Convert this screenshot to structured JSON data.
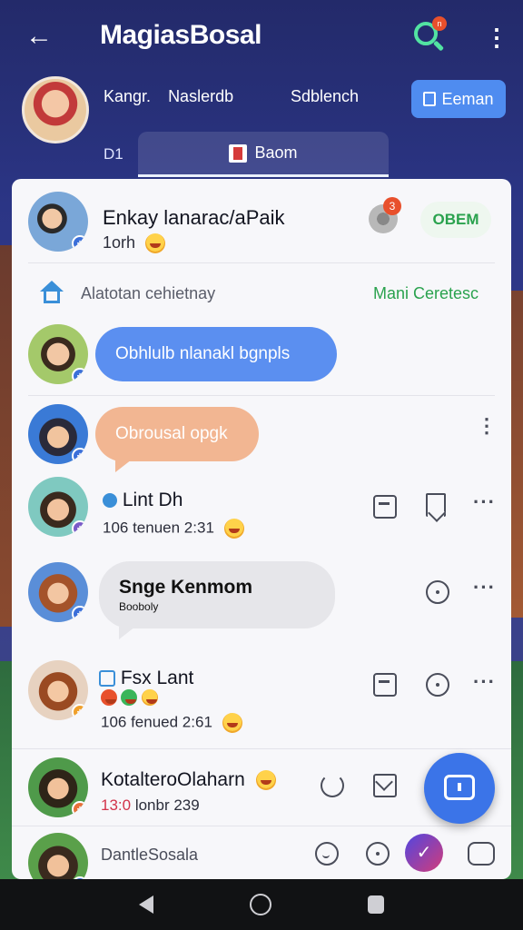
{
  "header": {
    "title": "MagiasBosal",
    "search_badge": "n",
    "profile_name": "Kangr.",
    "profile_sub": "Naslerdb",
    "sub_link": "Sdblench",
    "cta_label": "Eeman",
    "tab_left": "D1",
    "tab_active": "Baom"
  },
  "group": {
    "name": "Enkay lanarac/aPaik",
    "time": "1orh",
    "badge_count": "3",
    "pill": "OBEM"
  },
  "section": {
    "label": "Alatotan cehietnay",
    "action": "Mani Ceretesc"
  },
  "messages": {
    "m1_bubble": "Obhlulb nlanakl bgnpls",
    "m2_bubble": "Obrousal opgk",
    "m3_name": "Lint Dh",
    "m3_meta": "106 tenuen 2:31",
    "m4_title": "Snge Kenmom",
    "m4_sub": "Booboly",
    "m5_name": "Fsx Lant",
    "m5_meta": "106 fenued 2:61",
    "m6_name": "KotalteroOlaharn",
    "m6_time": "13:0",
    "m6_meta": "lonbr 239",
    "m7_name": "DantleSosala"
  },
  "colors": {
    "accent_blue": "#4f8cf0",
    "green": "#2aa24e",
    "badge_red": "#e8502c"
  }
}
